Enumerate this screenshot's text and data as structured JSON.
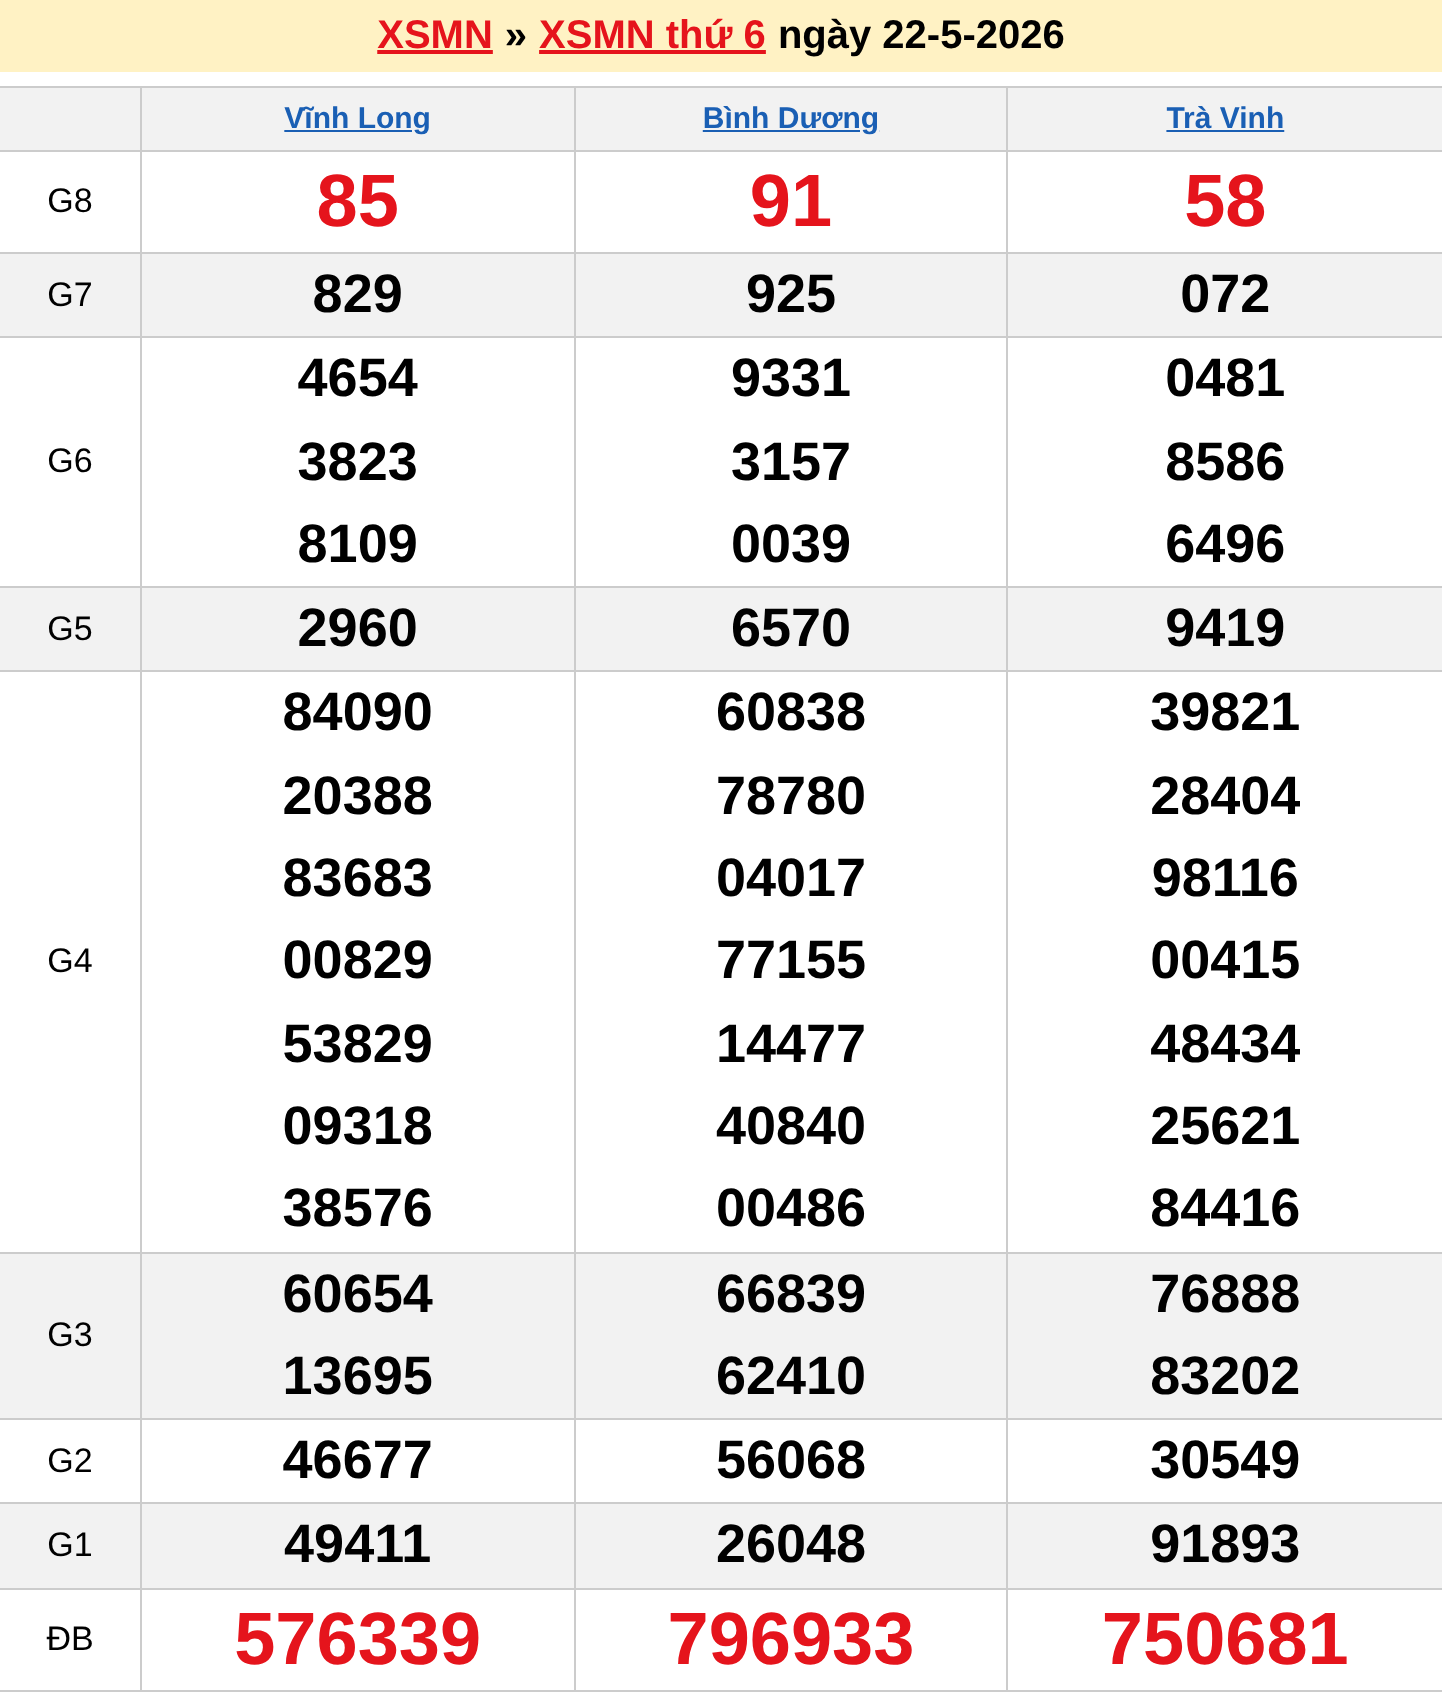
{
  "title": {
    "parts": [
      {
        "kind": "link",
        "text": "XSMN"
      },
      {
        "kind": "text",
        "text": "»"
      },
      {
        "kind": "link",
        "text": "XSMN thứ 6"
      },
      {
        "kind": "text",
        "text": "ngày 22-5-2026"
      }
    ]
  },
  "table": {
    "columns": [
      "Vĩnh Long",
      "Bình Dương",
      "Trà Vinh"
    ],
    "rows": [
      {
        "prize": "G8",
        "kind": "big",
        "values": [
          [
            "85"
          ],
          [
            "91"
          ],
          [
            "58"
          ]
        ]
      },
      {
        "prize": "G7",
        "kind": "normal",
        "values": [
          [
            "829"
          ],
          [
            "925"
          ],
          [
            "072"
          ]
        ]
      },
      {
        "prize": "G6",
        "kind": "normal",
        "values": [
          [
            "4654",
            "3823",
            "8109"
          ],
          [
            "9331",
            "3157",
            "0039"
          ],
          [
            "0481",
            "8586",
            "6496"
          ]
        ]
      },
      {
        "prize": "G5",
        "kind": "normal",
        "values": [
          [
            "2960"
          ],
          [
            "6570"
          ],
          [
            "9419"
          ]
        ]
      },
      {
        "prize": "G4",
        "kind": "normal",
        "values": [
          [
            "84090",
            "20388",
            "83683",
            "00829",
            "53829",
            "09318",
            "38576"
          ],
          [
            "60838",
            "78780",
            "04017",
            "77155",
            "14477",
            "40840",
            "00486"
          ],
          [
            "39821",
            "28404",
            "98116",
            "00415",
            "48434",
            "25621",
            "84416"
          ]
        ]
      },
      {
        "prize": "G3",
        "kind": "normal",
        "values": [
          [
            "60654",
            "13695"
          ],
          [
            "66839",
            "62410"
          ],
          [
            "76888",
            "83202"
          ]
        ]
      },
      {
        "prize": "G2",
        "kind": "normal",
        "values": [
          [
            "46677"
          ],
          [
            "56068"
          ],
          [
            "30549"
          ]
        ]
      },
      {
        "prize": "G1",
        "kind": "normal",
        "values": [
          [
            "49411"
          ],
          [
            "26048"
          ],
          [
            "91893"
          ]
        ]
      },
      {
        "prize": "ĐB",
        "kind": "big",
        "values": [
          [
            "576339"
          ],
          [
            "796933"
          ],
          [
            "750681"
          ]
        ]
      }
    ]
  }
}
